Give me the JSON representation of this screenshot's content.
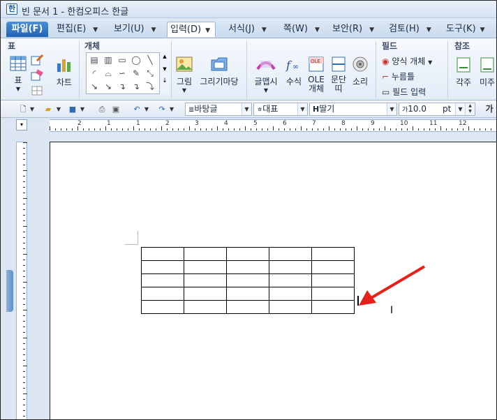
{
  "window": {
    "title": "빈 문서 1 - 한컴오피스 한글",
    "app_icon": "hwp-icon"
  },
  "menu": {
    "file": "파일(F)",
    "tabs": [
      {
        "label": "편집(E)"
      },
      {
        "label": "보기(U)"
      },
      {
        "label": "입력(D)",
        "active": true
      },
      {
        "label": "서식(J)"
      },
      {
        "label": "쪽(W)"
      },
      {
        "label": "보안(R)"
      },
      {
        "label": "검토(H)"
      },
      {
        "label": "도구(K)"
      }
    ]
  },
  "ribbon": {
    "groups": {
      "table": "표",
      "object": "개체",
      "field": "필드",
      "reference": "참조"
    },
    "table_label": "표",
    "chart_label": "차트",
    "picture_label": "그림",
    "drawing_label": "그리기마당",
    "textart_label": "글맵시",
    "formula_label": "수식",
    "ole_label": "OLE 개체",
    "paragraph_label": "문단 띠",
    "sound_label": "소리",
    "form_object": "양식 개체",
    "button": "누름틀",
    "field_input": "필드 입력",
    "caption": "각주",
    "endnote": "미주"
  },
  "format_bar": {
    "style": "바탕글",
    "font_lang": "대표",
    "font": "딸기",
    "size": "10.0",
    "unit": "pt",
    "bold": "가"
  },
  "ruler": {
    "h_numbers": [
      "2",
      "1",
      "1",
      "2",
      "3",
      "4",
      "5",
      "6",
      "7",
      "8",
      "9",
      "10",
      "11",
      "12"
    ]
  },
  "colors": {
    "accent": "#1f63b4",
    "arrow": "#e8201a"
  }
}
